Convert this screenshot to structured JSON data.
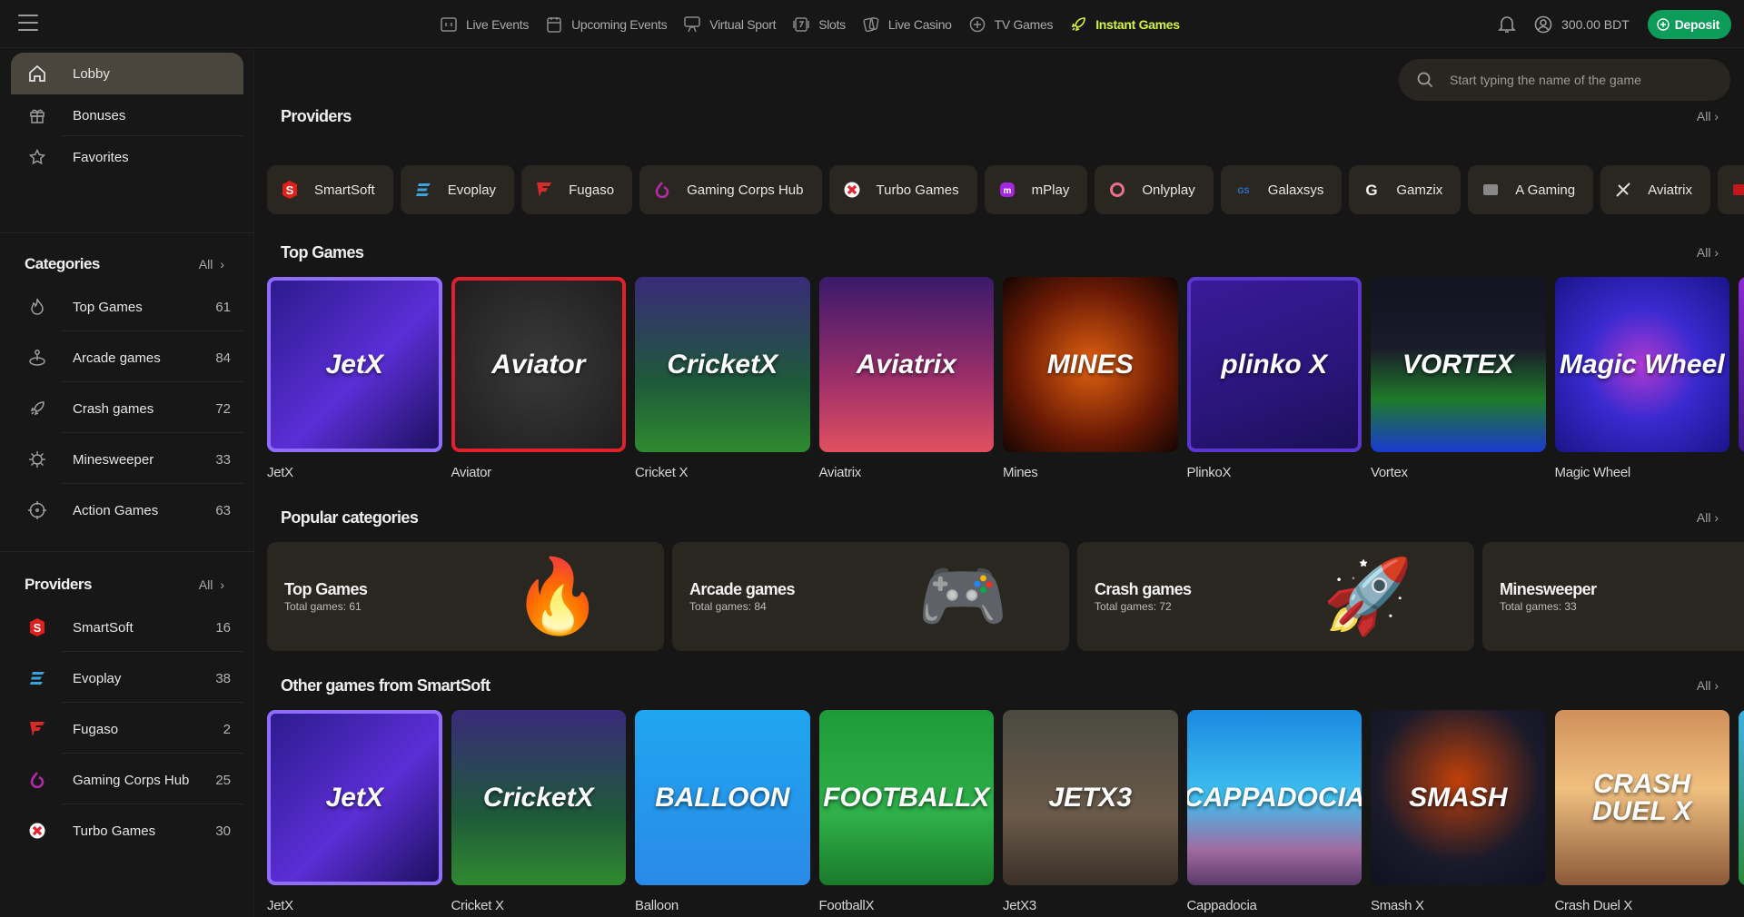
{
  "header": {
    "menu_icon": "hamburger-icon",
    "nav": [
      {
        "label": "Live Events",
        "icon": "scoreboard-icon",
        "active": false
      },
      {
        "label": "Upcoming Events",
        "icon": "calendar-icon",
        "active": false
      },
      {
        "label": "Virtual Sport",
        "icon": "gamepad-monitor-icon",
        "active": false
      },
      {
        "label": "Slots",
        "icon": "slot-seven-icon",
        "active": false
      },
      {
        "label": "Live Casino",
        "icon": "cards-icon",
        "active": false
      },
      {
        "label": "TV Games",
        "icon": "tv-games-icon",
        "active": false
      },
      {
        "label": "Instant Games",
        "icon": "rocket-icon",
        "active": true
      }
    ],
    "balance": "300.00 BDT",
    "deposit_label": "Deposit",
    "colors": {
      "active_nav": "#d7f23a",
      "deposit": "#0e9c5b"
    }
  },
  "sidebar": {
    "menu": [
      {
        "label": "Lobby",
        "icon": "home-icon",
        "active": true
      },
      {
        "label": "Bonuses",
        "icon": "gift-icon",
        "active": false
      },
      {
        "label": "Favorites",
        "icon": "star-icon",
        "active": false
      }
    ],
    "categories": {
      "title": "Categories",
      "all_label": "All",
      "items": [
        {
          "label": "Top Games",
          "count": "61",
          "icon": "flame-icon"
        },
        {
          "label": "Arcade games",
          "count": "84",
          "icon": "joystick-icon"
        },
        {
          "label": "Crash games",
          "count": "72",
          "icon": "rocket-icon"
        },
        {
          "label": "Minesweeper",
          "count": "33",
          "icon": "mine-icon"
        },
        {
          "label": "Action Games",
          "count": "63",
          "icon": "crosshair-icon"
        }
      ]
    },
    "providers": {
      "title": "Providers",
      "all_label": "All",
      "items": [
        {
          "label": "SmartSoft",
          "count": "16",
          "icon": "smartsoft-logo-icon",
          "color": "#e0201b"
        },
        {
          "label": "Evoplay",
          "count": "38",
          "icon": "evoplay-logo-icon",
          "color": "#3aa5dc"
        },
        {
          "label": "Fugaso",
          "count": "2",
          "icon": "fugaso-logo-icon",
          "color": "#d82a2a"
        },
        {
          "label": "Gaming Corps Hub",
          "count": "25",
          "icon": "gaming-corps-logo-icon",
          "color": "#b52aa6"
        },
        {
          "label": "Turbo Games",
          "count": "30",
          "icon": "turbo-games-logo-icon",
          "color": "#e4222d"
        }
      ]
    }
  },
  "search": {
    "placeholder": "Start typing the name of the game"
  },
  "providers_section": {
    "title": "Providers",
    "all_label": "All",
    "chips": [
      {
        "label": "SmartSoft",
        "icon": "smartsoft-logo-icon",
        "color": "#e0201b"
      },
      {
        "label": "Evoplay",
        "icon": "evoplay-logo-icon",
        "color": "#3aa5dc"
      },
      {
        "label": "Fugaso",
        "icon": "fugaso-logo-icon",
        "color": "#d82a2a"
      },
      {
        "label": "Gaming Corps Hub",
        "icon": "gaming-corps-logo-icon",
        "color": "#b52aa6"
      },
      {
        "label": "Turbo Games",
        "icon": "turbo-games-logo-icon",
        "color": "#e4222d"
      },
      {
        "label": "mPlay",
        "icon": "mplay-logo-icon",
        "color": "#a326e0"
      },
      {
        "label": "Onlyplay",
        "icon": "onlyplay-logo-icon",
        "color": "#e8708a"
      },
      {
        "label": "Galaxsys",
        "icon": "galaxsys-logo-icon",
        "color": "#2f6fd0"
      },
      {
        "label": "Gamzix",
        "icon": "gamzix-logo-icon",
        "color": "#f0f0f0"
      },
      {
        "label": "A Gaming",
        "icon": "provider-logo-icon",
        "color": "#888888"
      },
      {
        "label": "Aviatrix",
        "icon": "aviatrix-logo-icon",
        "color": "#dddddd"
      },
      {
        "label": "",
        "icon": "provider-logo-icon",
        "color": "#c4161c"
      }
    ]
  },
  "top_games": {
    "title": "Top Games",
    "all_label": "All",
    "items": [
      {
        "name": "JetX",
        "art": "JetX",
        "bg": "linear-gradient(135deg,#2a1a8a,#5b2ed6 55%,#1b0f5a)",
        "border": "#8f6bff"
      },
      {
        "name": "Aviator",
        "art": "Aviator",
        "bg": "radial-gradient(circle,#3a3a3a,#1d1d1d)",
        "border": "#e0202a"
      },
      {
        "name": "Cricket X",
        "art": "CricketX",
        "bg": "linear-gradient(180deg,#3a2a7a,#1e5a3a 60%,#2f8a2f)",
        "border": ""
      },
      {
        "name": "Aviatrix",
        "art": "Aviatrix",
        "bg": "linear-gradient(180deg,#3a1a6a,#a0306a 60%,#e05060)",
        "border": ""
      },
      {
        "name": "Mines",
        "art": "MINES",
        "bg": "radial-gradient(circle,#e06010,#6a1a05 60%,#140503)",
        "border": ""
      },
      {
        "name": "PlinkoX",
        "art": "plinko X",
        "bg": "linear-gradient(160deg,#3a1a9a,#2a157a 60%,#1a0f55)",
        "border": "#5a36d0"
      },
      {
        "name": "Vortex",
        "art": "VORTEX",
        "bg": "linear-gradient(180deg,#111320,#1a1a2a 40%,#1e7a2a 70%,#1a3ad0)",
        "border": ""
      },
      {
        "name": "Magic Wheel",
        "art": "Magic Wheel",
        "bg": "radial-gradient(circle,#b03ad0,#3a2ad0 45%,#1a148a)",
        "border": ""
      },
      {
        "name": "",
        "art": "",
        "bg": "linear-gradient(180deg,#8a2ad0,#3a1a8a)",
        "border": ""
      }
    ]
  },
  "popular_categories": {
    "title": "Popular categories",
    "all_label": "All",
    "items": [
      {
        "name": "Top Games",
        "total": "Total games: 61",
        "art": "🔥"
      },
      {
        "name": "Arcade games",
        "total": "Total games: 84",
        "art": "🎮"
      },
      {
        "name": "Crash games",
        "total": "Total games: 72",
        "art": "🚀"
      },
      {
        "name": "Minesweeper",
        "total": "Total games: 33",
        "art": ""
      }
    ]
  },
  "other_games": {
    "title": "Other games from SmartSoft",
    "all_label": "All",
    "items": [
      {
        "name": "JetX",
        "art": "JetX",
        "bg": "linear-gradient(135deg,#2a1a8a,#5b2ed6 55%,#1b0f5a)",
        "border": "#8f6bff"
      },
      {
        "name": "Cricket X",
        "art": "CricketX",
        "bg": "linear-gradient(180deg,#3a2a7a,#1e5a3a 60%,#2f8a2f)",
        "border": ""
      },
      {
        "name": "Balloon",
        "art": "BALLOON",
        "bg": "linear-gradient(180deg,#1fa6f0,#2a8ae8)",
        "border": ""
      },
      {
        "name": "FootballX",
        "art": "FOOTBALLX",
        "bg": "linear-gradient(180deg,#1e9a3a,#2fb04a 60%,#1a7a2a)",
        "border": ""
      },
      {
        "name": "JetX3",
        "art": "JETX3",
        "bg": "linear-gradient(180deg,#4a4a40,#6a5a4a 60%,#3a3028)",
        "border": ""
      },
      {
        "name": "Cappadocia",
        "art": "CAPPADOCIA",
        "bg": "linear-gradient(180deg,#1a8ae0,#40c0f0 50%,#a06aa0 80%,#5a3a6a)",
        "border": ""
      },
      {
        "name": "Smash X",
        "art": "SMASH",
        "bg": "radial-gradient(circle at 50% 40%,#c0400a,#1a1a2a 60%,#0f1020)",
        "border": ""
      },
      {
        "name": "Crash Duel X",
        "art": "CRASH DUEL X",
        "bg": "linear-gradient(180deg,#d0905a,#f0c080 45%,#8a5a3a)",
        "border": ""
      },
      {
        "name": "",
        "art": "",
        "bg": "linear-gradient(180deg,#40b0e0,#2a8a3a)",
        "border": ""
      }
    ]
  }
}
